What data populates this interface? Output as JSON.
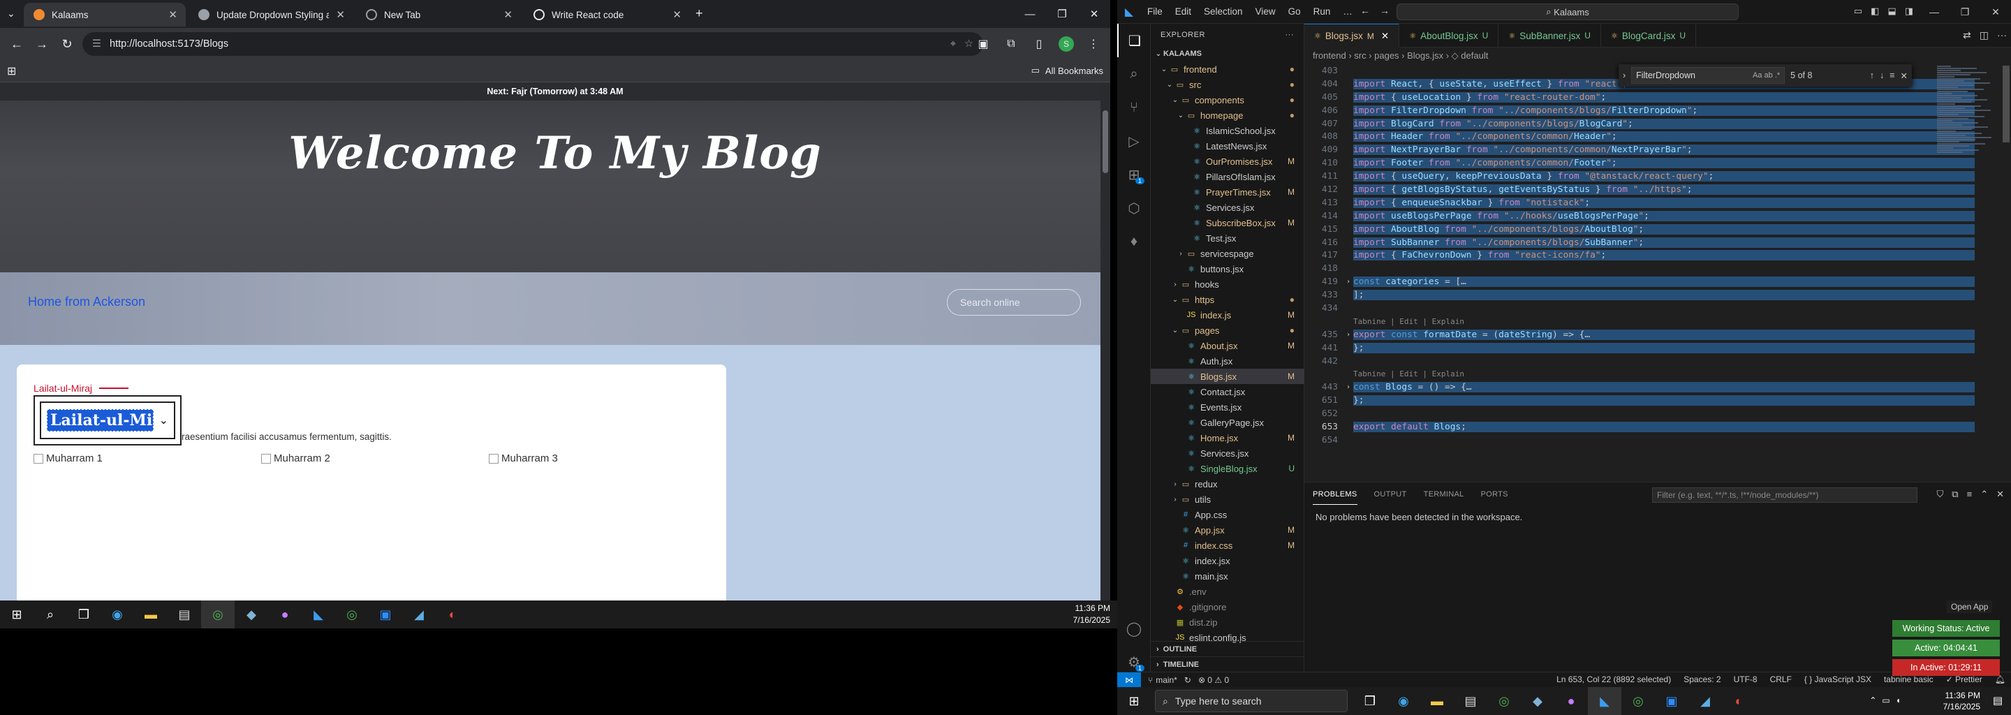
{
  "chrome": {
    "tabs": [
      {
        "title": "Kalaams",
        "active": true,
        "color": "#f28b30"
      },
      {
        "title": "Update Dropdown Styling and",
        "active": false,
        "color": "#9aa0a6"
      },
      {
        "title": "New Tab",
        "active": false,
        "color": "#9aa0a6"
      },
      {
        "title": "Write React code",
        "active": false,
        "color": "#e8eaed"
      }
    ],
    "url": "http://localhost:5173/Blogs",
    "all_bookmarks": "All Bookmarks",
    "avatar_letter": "S"
  },
  "page": {
    "prayer_bar": "Next: Fajr (Tomorrow) at 3:48 AM",
    "hero_title": "Welcome To My Blog",
    "breadcrumb": "Home from Ackerson",
    "search_placeholder": "Search online",
    "category_label": "Lailat-ul-Miraj",
    "dropdown_value": "Lailat-ul-Miraj",
    "description": "raesentium facilisi accusamus fermentum, sagittis.",
    "images": [
      "Muharram 1",
      "Muharram 2",
      "Muharram 3"
    ]
  },
  "taskbar_left": {
    "time": "11:36 PM",
    "date": "7/16/2025"
  },
  "vscode": {
    "menu": [
      "File",
      "Edit",
      "Selection",
      "View",
      "Go",
      "Run",
      "…"
    ],
    "command_center": "Kalaams",
    "explorer_title": "EXPLORER",
    "root": "KALAAMS",
    "tree": [
      {
        "name": "frontend",
        "depth": 1,
        "type": "folder-open",
        "status": "dot"
      },
      {
        "name": "src",
        "depth": 2,
        "type": "folder-open",
        "status": "dot"
      },
      {
        "name": "components",
        "depth": 3,
        "type": "folder-open",
        "status": "dot"
      },
      {
        "name": "homepage",
        "depth": 4,
        "type": "folder-open",
        "status": "dot"
      },
      {
        "name": "IslamicSchool.jsx",
        "depth": 5,
        "type": "jsx",
        "status": ""
      },
      {
        "name": "LatestNews.jsx",
        "depth": 5,
        "type": "jsx",
        "status": ""
      },
      {
        "name": "OurPromises.jsx",
        "depth": 5,
        "type": "jsx",
        "status": "M"
      },
      {
        "name": "PillarsOfIslam.jsx",
        "depth": 5,
        "type": "jsx",
        "status": ""
      },
      {
        "name": "PrayerTimes.jsx",
        "depth": 5,
        "type": "jsx",
        "status": "M"
      },
      {
        "name": "Services.jsx",
        "depth": 5,
        "type": "jsx",
        "status": ""
      },
      {
        "name": "SubscribeBox.jsx",
        "depth": 5,
        "type": "jsx",
        "status": "M"
      },
      {
        "name": "Test.jsx",
        "depth": 5,
        "type": "jsx",
        "status": ""
      },
      {
        "name": "servicespage",
        "depth": 4,
        "type": "folder",
        "status": ""
      },
      {
        "name": "buttons.jsx",
        "depth": 4,
        "type": "jsx",
        "status": ""
      },
      {
        "name": "hooks",
        "depth": 3,
        "type": "folder",
        "status": ""
      },
      {
        "name": "https",
        "depth": 3,
        "type": "folder-open",
        "status": "dot"
      },
      {
        "name": "index.js",
        "depth": 4,
        "type": "js",
        "status": "M"
      },
      {
        "name": "pages",
        "depth": 3,
        "type": "folder-open",
        "status": "dot"
      },
      {
        "name": "About.jsx",
        "depth": 4,
        "type": "jsx",
        "status": "M"
      },
      {
        "name": "Auth.jsx",
        "depth": 4,
        "type": "jsx",
        "status": ""
      },
      {
        "name": "Blogs.jsx",
        "depth": 4,
        "type": "jsx",
        "status": "M",
        "selected": true
      },
      {
        "name": "Contact.jsx",
        "depth": 4,
        "type": "jsx",
        "status": ""
      },
      {
        "name": "Events.jsx",
        "depth": 4,
        "type": "jsx",
        "status": ""
      },
      {
        "name": "GalleryPage.jsx",
        "depth": 4,
        "type": "jsx",
        "status": ""
      },
      {
        "name": "Home.jsx",
        "depth": 4,
        "type": "jsx",
        "status": "M"
      },
      {
        "name": "Services.jsx",
        "depth": 4,
        "type": "jsx",
        "status": ""
      },
      {
        "name": "SingleBlog.jsx",
        "depth": 4,
        "type": "jsx",
        "status": "U"
      },
      {
        "name": "redux",
        "depth": 3,
        "type": "folder",
        "status": ""
      },
      {
        "name": "utils",
        "depth": 3,
        "type": "folder",
        "status": ""
      },
      {
        "name": "App.css",
        "depth": 3,
        "type": "css",
        "status": ""
      },
      {
        "name": "App.jsx",
        "depth": 3,
        "type": "jsx",
        "status": "M"
      },
      {
        "name": "index.css",
        "depth": 3,
        "type": "css",
        "status": "M"
      },
      {
        "name": "index.jsx",
        "depth": 3,
        "type": "jsx",
        "status": ""
      },
      {
        "name": "main.jsx",
        "depth": 3,
        "type": "jsx",
        "status": ""
      },
      {
        "name": ".env",
        "depth": 2,
        "type": "env",
        "status": ""
      },
      {
        "name": ".gitignore",
        "depth": 2,
        "type": "git",
        "status": ""
      },
      {
        "name": "dist.zip",
        "depth": 2,
        "type": "zip",
        "status": ""
      },
      {
        "name": "eslint.config.js",
        "depth": 2,
        "type": "js",
        "status": ""
      }
    ],
    "outline": "OUTLINE",
    "timeline": "TIMELINE",
    "editor_tabs": [
      {
        "name": "Blogs.jsx",
        "status": "M",
        "active": true
      },
      {
        "name": "AboutBlog.jsx",
        "status": "U",
        "active": false
      },
      {
        "name": "SubBanner.jsx",
        "status": "U",
        "active": false
      },
      {
        "name": "BlogCard.jsx",
        "status": "U",
        "active": false
      }
    ],
    "breadcrumbs": "frontend › src › pages › Blogs.jsx › ◇ default",
    "find_query": "FilterDropdown",
    "find_result": "5 of 8",
    "code_lines": [
      {
        "no": "403",
        "text": "",
        "hl": false,
        "fold": ""
      },
      {
        "no": "404",
        "text": "import React, { useState, useEffect } from \"react\";",
        "hl": true,
        "fold": ""
      },
      {
        "no": "405",
        "text": "import { useLocation } from \"react-router-dom\";",
        "hl": true,
        "fold": ""
      },
      {
        "no": "406",
        "text": "import FilterDropdown from \"../components/blogs/FilterDropdown\";",
        "hl": true,
        "fold": ""
      },
      {
        "no": "407",
        "text": "import BlogCard from \"../components/blogs/BlogCard\";",
        "hl": true,
        "fold": ""
      },
      {
        "no": "408",
        "text": "import Header from \"../components/common/Header\";",
        "hl": true,
        "fold": ""
      },
      {
        "no": "409",
        "text": "import NextPrayerBar from \"../components/common/NextPrayerBar\";",
        "hl": true,
        "fold": ""
      },
      {
        "no": "410",
        "text": "import Footer from \"../components/common/Footer\";",
        "hl": true,
        "fold": ""
      },
      {
        "no": "411",
        "text": "import { useQuery, keepPreviousData } from \"@tanstack/react-query\";",
        "hl": true,
        "fold": ""
      },
      {
        "no": "412",
        "text": "import { getBlogsByStatus, getEventsByStatus } from \"../https\";",
        "hl": true,
        "fold": ""
      },
      {
        "no": "413",
        "text": "import { enqueueSnackbar } from \"notistack\";",
        "hl": true,
        "fold": ""
      },
      {
        "no": "414",
        "text": "import useBlogsPerPage from \"../hooks/useBlogsPerPage\";",
        "hl": true,
        "fold": ""
      },
      {
        "no": "415",
        "text": "import AboutBlog from \"../components/blogs/AboutBlog\";",
        "hl": true,
        "fold": ""
      },
      {
        "no": "416",
        "text": "import SubBanner from \"../components/blogs/SubBanner\";",
        "hl": true,
        "fold": ""
      },
      {
        "no": "417",
        "text": "import { FaChevronDown } from \"react-icons/fa\";",
        "hl": true,
        "fold": ""
      },
      {
        "no": "418",
        "text": "",
        "hl": false,
        "fold": ""
      },
      {
        "no": "419",
        "text": "const categories = […",
        "hl": true,
        "fold": ">"
      },
      {
        "no": "433",
        "text": "];",
        "hl": true,
        "fold": ""
      },
      {
        "no": "434",
        "text": "",
        "hl": false,
        "fold": ""
      },
      {
        "hint": "Tabnine | Edit | Explain"
      },
      {
        "no": "435",
        "text": "export const formatDate = (dateString) => {…",
        "hl": true,
        "fold": ">"
      },
      {
        "no": "441",
        "text": "};",
        "hl": true,
        "fold": ""
      },
      {
        "no": "442",
        "text": "",
        "hl": false,
        "fold": ""
      },
      {
        "hint": "Tabnine | Edit | Explain"
      },
      {
        "no": "443",
        "text": "const Blogs = () => {…",
        "hl": true,
        "fold": ">"
      },
      {
        "no": "651",
        "text": "};",
        "hl": true,
        "fold": ""
      },
      {
        "no": "652",
        "text": "",
        "hl": false,
        "fold": ""
      },
      {
        "no": "653",
        "text": "export default Blogs;",
        "hl": true,
        "fold": "",
        "cur": true
      },
      {
        "no": "654",
        "text": "",
        "hl": false,
        "fold": ""
      }
    ],
    "panel_tabs": [
      "PROBLEMS",
      "OUTPUT",
      "TERMINAL",
      "PORTS"
    ],
    "panel_filter": "Filter (e.g. text, **/*.ts, !**/node_modules/**)",
    "panel_message": "No problems have been detected in the workspace.",
    "status": {
      "branch": "main*",
      "problems": "⊗ 0 ⚠ 0",
      "cursor": "Ln 653, Col 22 (8892 selected)",
      "spaces": "Spaces: 2",
      "encoding": "UTF-8",
      "eol": "CRLF",
      "lang": "{ } JavaScript JSX",
      "tabnine": "tabnine basic",
      "prettier": "✓ Prettier"
    }
  },
  "widgets": {
    "open_app": "Open App",
    "working_status": "Working Status: Active",
    "active_time": "Active: 04:04:41",
    "inactive_time": "In Active: 01:29:11",
    "colors": {
      "working": "#2e7d32",
      "active": "#388e3c",
      "inactive": "#c62828"
    }
  },
  "taskbar_right": {
    "search_placeholder": "Type here to search",
    "time": "11:36 PM",
    "date": "7/16/2025"
  }
}
